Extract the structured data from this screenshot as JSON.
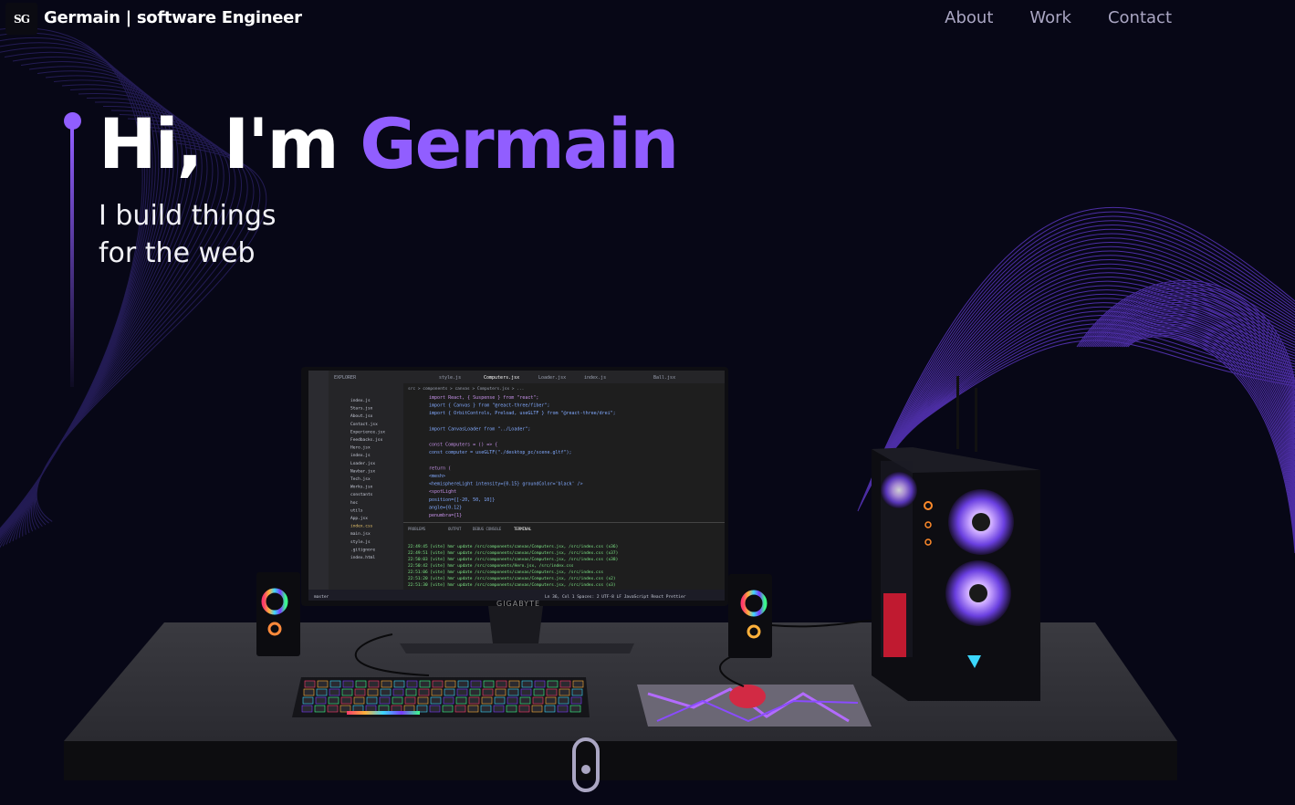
{
  "nav": {
    "logo_text": "SG",
    "brand": "Germain  | software Engineer",
    "links": [
      {
        "label": "About"
      },
      {
        "label": "Work"
      },
      {
        "label": "Contact"
      }
    ]
  },
  "hero": {
    "greeting": "Hi, I'm",
    "name": "Germain",
    "tagline_line1": "I build things",
    "tagline_line2": "for the web"
  },
  "scene": {
    "monitor_brand": "GIGABYTE",
    "editor": {
      "tabs": [
        "EXPLORER",
        "style.js",
        "Computers.jsx",
        "Loader.jsx",
        "index.js",
        "Ball.jsx"
      ],
      "breadcrumb": "src > components > canvas > Computers.jsx > ...",
      "files": [
        "index.js",
        "Stars.jsx",
        "About.jsx",
        "Contact.jsx",
        "Experience.jsx",
        "Feedbacks.jsx",
        "Hero.jsx",
        "index.js",
        "Loader.jsx",
        "Navbar.jsx",
        "Tech.jsx",
        "Works.jsx",
        "constants",
        "hoc",
        "utils",
        "App.jsx",
        "index.css",
        "main.jsx",
        "style.js",
        ".gitignore",
        "index.html"
      ],
      "code_lines": [
        "import React, { Suspense } from \"react\";",
        "import { Canvas } from \"@react-three/fiber\";",
        "import { OrbitControls, Preload, useGLTF } from \"@react-three/drei\";",
        "",
        "import CanvasLoader from \"../Loader\";",
        "",
        "const Computers = () => {",
        "  const computer = useGLTF(\"./desktop_pc/scene.gltf\");",
        "",
        "  return (",
        "    <mesh>",
        "      <hemisphereLight intensity={0.15} groundColor='black' />",
        "      <spotLight",
        "        position={[-20, 50, 10]}",
        "        angle={0.12}",
        "        penumbra={1}"
      ],
      "panel_tabs": [
        "PROBLEMS",
        "OUTPUT",
        "DEBUG CONSOLE",
        "TERMINAL"
      ],
      "terminal_lines": [
        "22:49:45 [vite] hmr update /src/components/canvas/Computers.jsx, /src/index.css (x36)",
        "22:49:51 [vite] hmr update /src/components/canvas/Computers.jsx, /src/index.css (x37)",
        "22:50:03 [vite] hmr update /src/components/canvas/Computers.jsx, /src/index.css (x38)",
        "22:50:42 [vite] hmr update /src/components/Hero.jsx, /src/index.css",
        "22:51:06 [vite] hmr update /src/components/canvas/Computers.jsx, /src/index.css",
        "22:51:20 [vite] hmr update /src/components/canvas/Computers.jsx, /src/index.css (x2)",
        "22:51:30 [vite] hmr update /src/components/canvas/Computers.jsx, /src/index.css (x3)"
      ],
      "status_left": "master",
      "status_right": "Ln 36, Col 1   Spaces: 2   UTF-8   LF   JavaScript React   Prettier"
    }
  },
  "colors": {
    "background": "#070716",
    "accent": "#915eff",
    "nav_link": "#aaa6c3"
  },
  "icons": [
    "logo-icon",
    "scroll-indicator-icon"
  ]
}
